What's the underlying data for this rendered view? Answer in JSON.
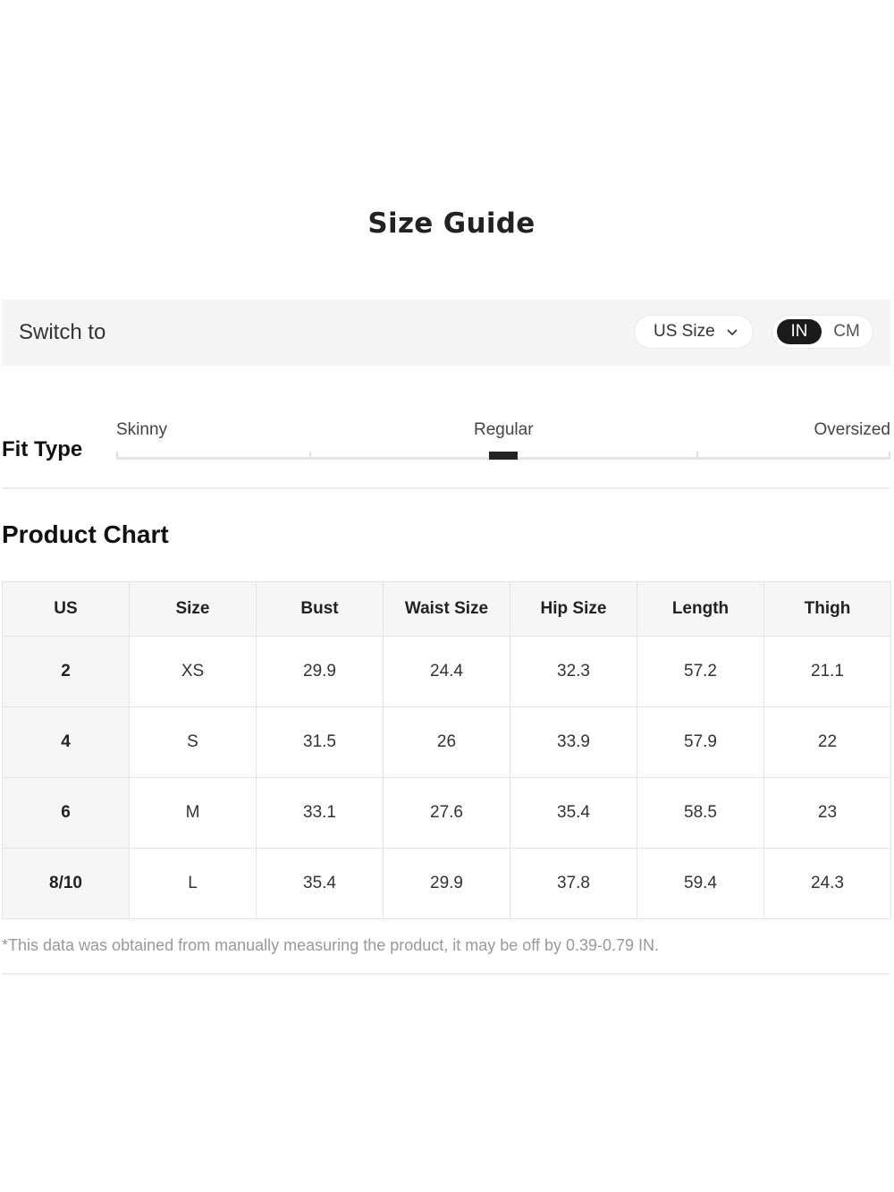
{
  "title": "Size Guide",
  "switch": {
    "label": "Switch to",
    "size_system": "US Size",
    "units": [
      "IN",
      "CM"
    ],
    "selected_unit": "IN"
  },
  "fit": {
    "label": "Fit Type",
    "options": [
      "Skinny",
      "Regular",
      "Oversized"
    ],
    "selected": "Regular"
  },
  "product_chart": {
    "title": "Product Chart",
    "headers": [
      "US",
      "Size",
      "Bust",
      "Waist Size",
      "Hip Size",
      "Length",
      "Thigh"
    ],
    "rows": [
      [
        "2",
        "XS",
        "29.9",
        "24.4",
        "32.3",
        "57.2",
        "21.1"
      ],
      [
        "4",
        "S",
        "31.5",
        "26",
        "33.9",
        "57.9",
        "22"
      ],
      [
        "6",
        "M",
        "33.1",
        "27.6",
        "35.4",
        "58.5",
        "23"
      ],
      [
        "8/10",
        "L",
        "35.4",
        "29.9",
        "37.8",
        "59.4",
        "24.3"
      ]
    ],
    "note": "*This data was obtained from manually measuring the product, it may be off by 0.39-0.79 IN."
  },
  "colors": {
    "accent": "#1a1a1a",
    "bar_background": "#f5f5f5",
    "header_background": "#f6f6f6",
    "note_text": "#999999"
  }
}
